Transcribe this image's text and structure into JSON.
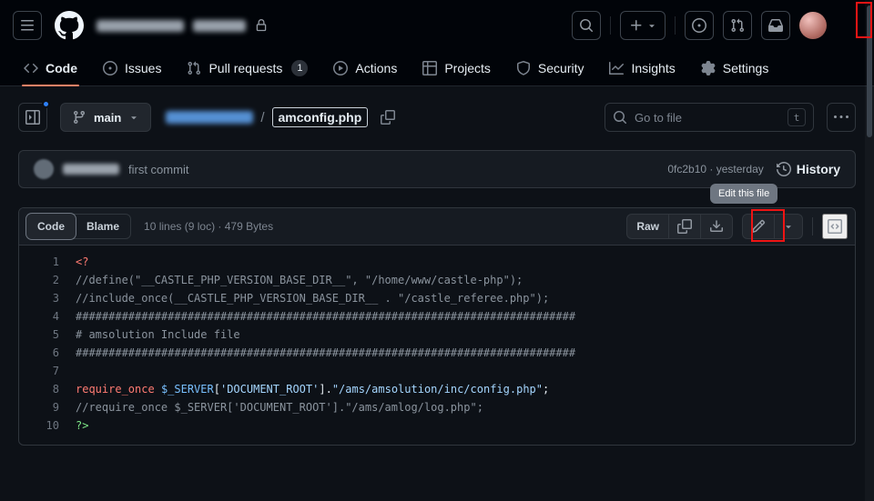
{
  "colors": {
    "page_bg": "#0d1117",
    "header_bg": "#010409",
    "panel_bg": "#161b22",
    "border": "#30363d",
    "text": "#e6edf3",
    "muted_text": "#7d8590",
    "tab_accent": "#f78166",
    "notification_dot": "#2f81f7",
    "annotation_red": "#ee1414",
    "tooltip_bg": "#6e7681",
    "syntax": {
      "keyword": "#ff7b72",
      "comment": "#8b949e",
      "string": "#a5d6ff",
      "constant": "#79c0ff",
      "close_tag": "#7ee787",
      "plain": "#e6edf3"
    }
  },
  "top_header": {
    "owner_redacted": true,
    "repo_redacted": true,
    "visibility_icon": "lock-icon"
  },
  "repo_tabs": [
    {
      "label": "Code",
      "selected": true
    },
    {
      "label": "Issues",
      "selected": false
    },
    {
      "label": "Pull requests",
      "badge": "1",
      "selected": false
    },
    {
      "label": "Actions",
      "selected": false
    },
    {
      "label": "Projects",
      "selected": false
    },
    {
      "label": "Security",
      "selected": false
    },
    {
      "label": "Insights",
      "selected": false
    },
    {
      "label": "Settings",
      "selected": false
    }
  ],
  "file_nav": {
    "branch_name": "main",
    "path_separator": "/",
    "file_name": "amconfig.php",
    "goto_file_placeholder": "Go to file",
    "goto_file_shortcut": "t"
  },
  "commit_bar": {
    "message": "first commit",
    "commit_meta": "0fc2b10 · yesterday",
    "history_label": "History"
  },
  "tooltip": {
    "text": "Edit this file"
  },
  "file_view": {
    "code_tab": "Code",
    "blame_tab": "Blame",
    "file_meta": "10 lines (9 loc) · 479 Bytes",
    "raw_button": "Raw"
  },
  "code": {
    "language": "php",
    "lines": [
      {
        "num": "1",
        "segments": [
          {
            "t": "<?",
            "c": "keyword"
          }
        ]
      },
      {
        "num": "2",
        "segments": [
          {
            "t": "//define(\"__CASTLE_PHP_VERSION_BASE_DIR__\", \"/home/www/castle-php\");",
            "c": "comment"
          }
        ]
      },
      {
        "num": "3",
        "segments": [
          {
            "t": "//include_once(__CASTLE_PHP_VERSION_BASE_DIR__ . \"/castle_referee.php\");",
            "c": "comment"
          }
        ]
      },
      {
        "num": "4",
        "segments": [
          {
            "t": "############################################################################",
            "c": "comment"
          }
        ]
      },
      {
        "num": "5",
        "segments": [
          {
            "t": "# amsolution Include file",
            "c": "comment"
          }
        ]
      },
      {
        "num": "6",
        "segments": [
          {
            "t": "############################################################################",
            "c": "comment"
          }
        ]
      },
      {
        "num": "7",
        "segments": []
      },
      {
        "num": "8",
        "segments": [
          {
            "t": "require_once",
            "c": "keyword"
          },
          {
            "t": " ",
            "c": "plain"
          },
          {
            "t": "$_SERVER",
            "c": "constant"
          },
          {
            "t": "[",
            "c": "plain"
          },
          {
            "t": "'DOCUMENT_ROOT'",
            "c": "string"
          },
          {
            "t": "]",
            "c": "plain"
          },
          {
            "t": ".",
            "c": "plain"
          },
          {
            "t": "\"/ams/amsolution/inc/config.php\"",
            "c": "string"
          },
          {
            "t": ";",
            "c": "plain"
          }
        ]
      },
      {
        "num": "9",
        "segments": [
          {
            "t": "//require_once $_SERVER['DOCUMENT_ROOT'].\"/ams/amlog/log.php\";",
            "c": "comment"
          }
        ]
      },
      {
        "num": "10",
        "segments": [
          {
            "t": "?>",
            "c": "tagclose"
          }
        ]
      }
    ]
  }
}
